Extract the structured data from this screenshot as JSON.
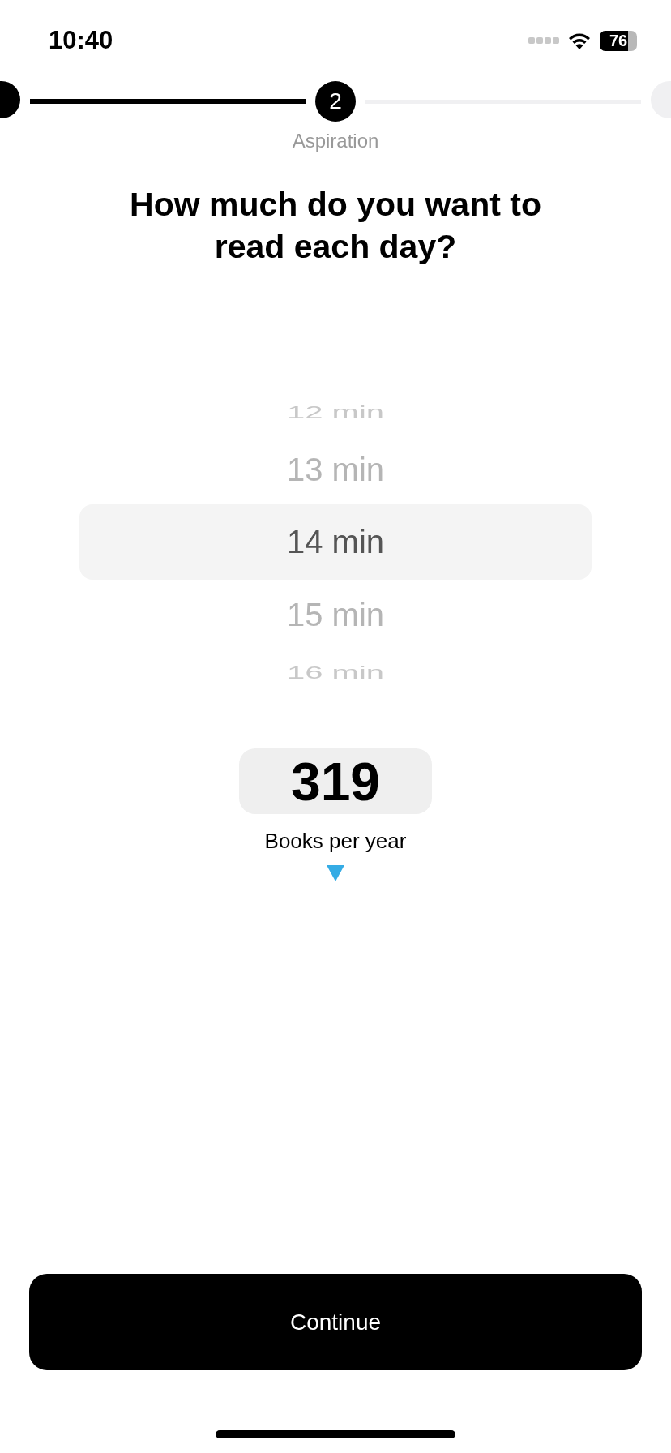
{
  "status_bar": {
    "time": "10:40",
    "battery": "76"
  },
  "stepper": {
    "steps": [
      {
        "done": true,
        "selected": false
      },
      {
        "label": "2",
        "done": false,
        "selected": true
      },
      {
        "done": false,
        "selected": false
      }
    ],
    "caption": "Aspiration"
  },
  "title": "How much do you want to read each day?",
  "picker": {
    "items": [
      {
        "label": "12 min",
        "selected": false
      },
      {
        "label": "13 min",
        "selected": false
      },
      {
        "label": "14 min",
        "selected": true
      },
      {
        "label": "15 min",
        "selected": false
      },
      {
        "label": "16 min",
        "selected": false
      }
    ]
  },
  "result": {
    "value": "319",
    "label": "Books per year"
  },
  "continue_button": "Continue"
}
